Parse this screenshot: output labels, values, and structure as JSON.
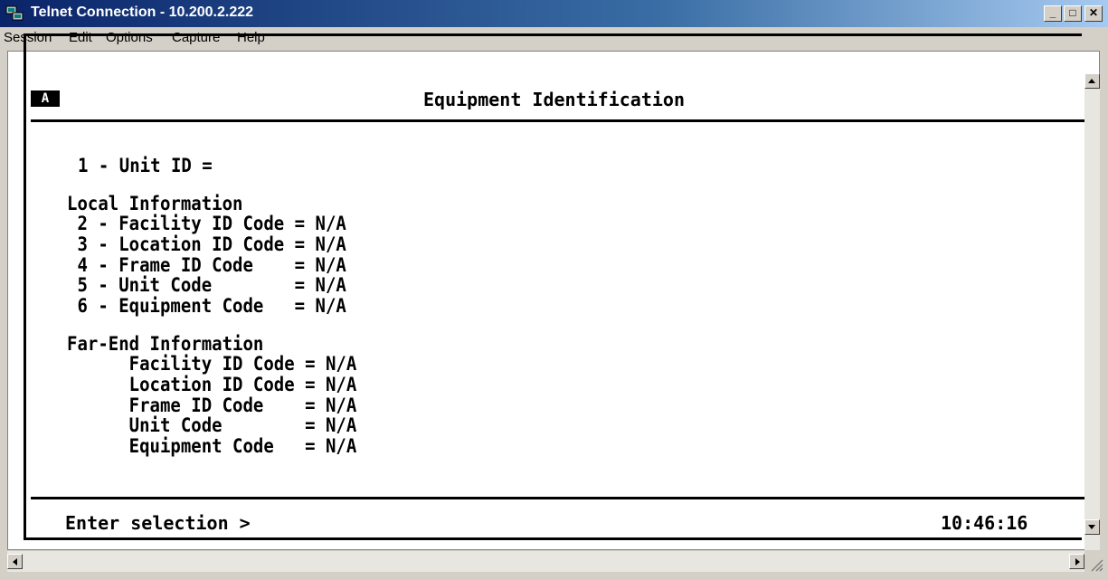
{
  "window": {
    "title": "Telnet Connection - 10.200.2.222"
  },
  "menu": [
    "Session",
    "Edit",
    "Options",
    "Capture",
    "Help"
  ],
  "terminal": {
    "mode_badge": "A",
    "screen_title": "Equipment Identification",
    "unit_id_line": "1 - Unit ID =",
    "local_header": "Local Information",
    "local_lines": [
      " 2 - Facility ID Code = N/A",
      " 3 - Location ID Code = N/A",
      " 4 - Frame ID Code    = N/A",
      " 5 - Unit Code        = N/A",
      " 6 - Equipment Code   = N/A"
    ],
    "far_header": "Far-End Information",
    "far_lines": [
      "      Facility ID Code = N/A",
      "      Location ID Code = N/A",
      "      Frame ID Code    = N/A",
      "      Unit Code        = N/A",
      "      Equipment Code   = N/A"
    ],
    "prompt": "Enter selection >",
    "clock": "10:46:16"
  }
}
